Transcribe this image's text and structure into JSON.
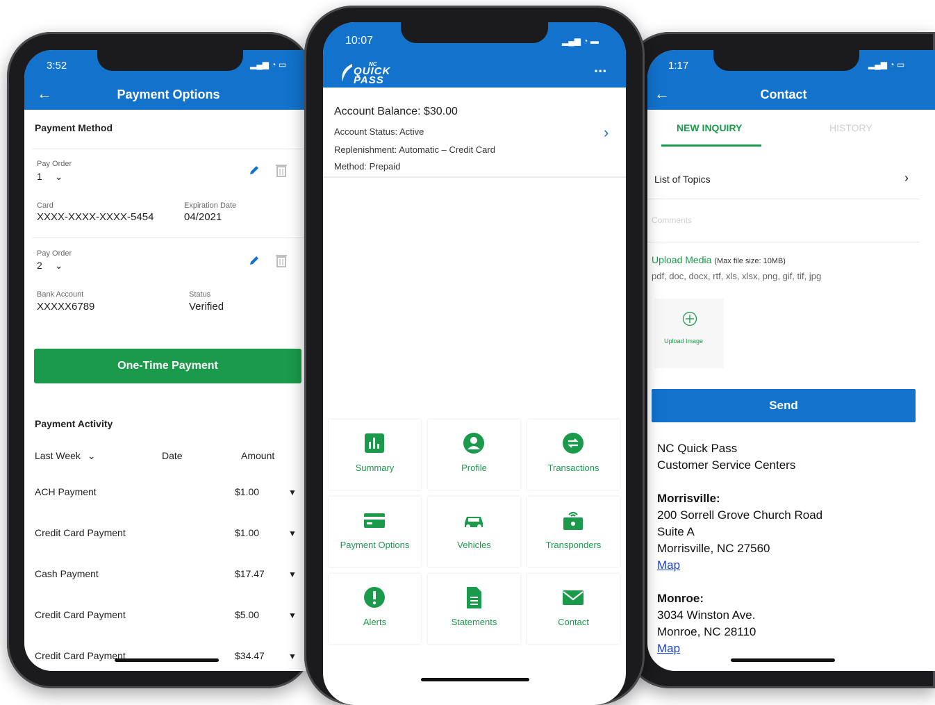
{
  "colors": {
    "brand_blue": "#1272cc",
    "accent_green": "#1a9a4a",
    "link_blue": "#1a3fd9"
  },
  "left": {
    "status_time": "3:52",
    "header_title": "Payment Options",
    "payment_method_title": "Payment Method",
    "methods": [
      {
        "order_label": "Pay Order",
        "order_value": "1",
        "field1_label": "Card",
        "field1_value": "XXXX-XXXX-XXXX-5454",
        "field2_label": "Expiration Date",
        "field2_value": "04/2021"
      },
      {
        "order_label": "Pay Order",
        "order_value": "2",
        "field1_label": "Bank Account",
        "field1_value": "XXXXX6789",
        "field2_label": "Status",
        "field2_value": "Verified"
      }
    ],
    "one_time_button": "One-Time Payment",
    "activity_title": "Payment Activity",
    "filter_value": "Last Week",
    "col_date": "Date",
    "col_amount": "Amount",
    "rows": [
      {
        "name": "ACH Payment",
        "amount": "$1.00"
      },
      {
        "name": "Credit Card Payment",
        "amount": "$1.00"
      },
      {
        "name": "Cash Payment",
        "amount": "$17.47"
      },
      {
        "name": "Credit Card Payment",
        "amount": "$5.00"
      },
      {
        "name": "Credit Card Payment",
        "amount": "$34.47"
      }
    ]
  },
  "center": {
    "status_time": "10:07",
    "logo_small": "NC",
    "logo_text": "QUICK PASS",
    "menu_label": "...",
    "balance": "Account Balance: $30.00",
    "account_status": "Account Status: Active",
    "replenishment": "Replenishment: Automatic – Credit Card",
    "method": "Method: Prepaid",
    "tiles": [
      {
        "label": "Summary",
        "icon": "bar-chart-icon"
      },
      {
        "label": "Profile",
        "icon": "user-icon"
      },
      {
        "label": "Transactions",
        "icon": "swap-icon"
      },
      {
        "label": "Payment Options",
        "icon": "credit-card-icon"
      },
      {
        "label": "Vehicles",
        "icon": "car-icon"
      },
      {
        "label": "Transponders",
        "icon": "transponder-icon"
      },
      {
        "label": "Alerts",
        "icon": "alert-icon"
      },
      {
        "label": "Statements",
        "icon": "document-icon"
      },
      {
        "label": "Contact",
        "icon": "mail-icon"
      }
    ]
  },
  "right": {
    "status_time": "1:17",
    "header_title": "Contact",
    "tab_new": "NEW INQUIRY",
    "tab_history": "HISTORY",
    "topics": "List of Topics",
    "comments_placeholder": "Comments",
    "upload_title": "Upload Media",
    "upload_note": "(Max file size: 10MB)",
    "file_types": "pdf, doc, docx, rtf, xls, xlsx, png, gif, tif, jpg",
    "upload_image_label": "Upload Image",
    "send_button": "Send",
    "centers_title_1": "NC Quick Pass",
    "centers_title_2": "Customer Service Centers",
    "loc1_name": "Morrisville:",
    "loc1_addr1": "200 Sorrell Grove Church Road",
    "loc1_addr2": "Suite A",
    "loc1_addr3": "Morrisville, NC 27560",
    "loc1_map": "Map",
    "loc2_name": "Monroe:",
    "loc2_addr1": "3034 Winston Ave.",
    "loc2_addr2": "Monroe, NC 28110",
    "loc2_map": "Map"
  }
}
